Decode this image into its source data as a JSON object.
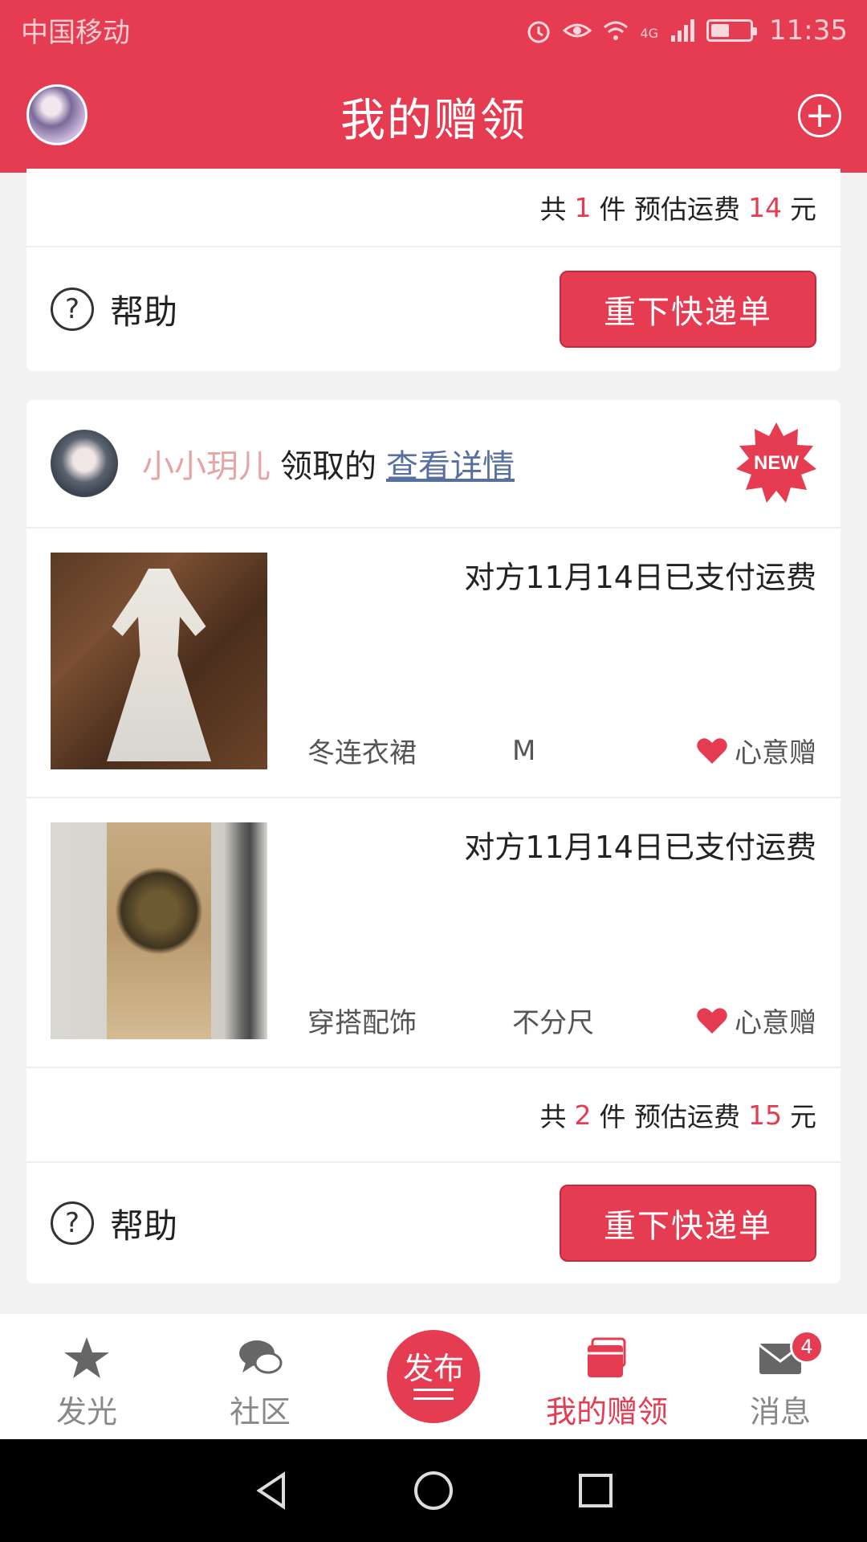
{
  "status_bar": {
    "carrier": "中国移动",
    "network": "4G",
    "time": "11:35"
  },
  "header": {
    "title": "我的赠领"
  },
  "card1": {
    "summary": {
      "prefix": "共",
      "count": "1",
      "unit": "件 预估运费",
      "fee": "14",
      "currency": "元"
    },
    "help_label": "帮助",
    "reorder_label": "重下快递单"
  },
  "card2": {
    "receiver": {
      "name": "小小玥儿",
      "action": "领取的",
      "detail_link": "查看详情",
      "badge": "NEW"
    },
    "items": [
      {
        "status": "对方11月14日已支付运费",
        "category": "冬连衣裙",
        "size": "M",
        "type": "心意赠"
      },
      {
        "status": "对方11月14日已支付运费",
        "category": "穿搭配饰",
        "size": "不分尺",
        "type": "心意赠"
      }
    ],
    "summary": {
      "prefix": "共",
      "count": "2",
      "unit": "件 预估运费",
      "fee": "15",
      "currency": "元"
    },
    "help_label": "帮助",
    "reorder_label": "重下快递单"
  },
  "bottom_nav": {
    "items": [
      {
        "label": "发光",
        "icon": "star-icon"
      },
      {
        "label": "社区",
        "icon": "chat-icon"
      },
      {
        "label": "发布",
        "icon": "publish-icon"
      },
      {
        "label": "我的赠领",
        "icon": "gifts-icon",
        "active": true
      },
      {
        "label": "消息",
        "icon": "mail-icon",
        "badge": "4"
      }
    ]
  },
  "colors": {
    "accent": "#e63c51",
    "receiver_name": "#e8a3a3",
    "link": "#5870a0"
  }
}
